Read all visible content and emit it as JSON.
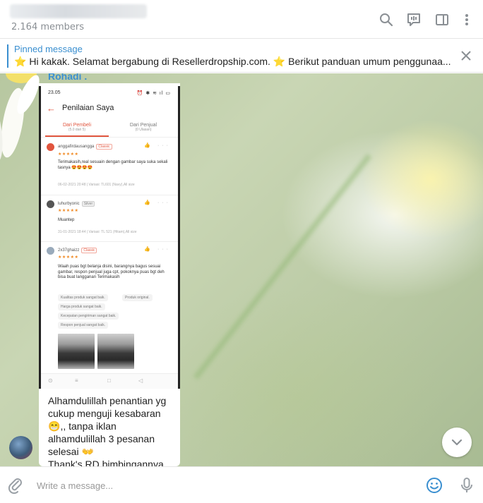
{
  "header": {
    "members": "2.164 members",
    "icons": [
      "search-icon",
      "video-chat-icon",
      "sidebar-toggle-icon",
      "more-vertical-icon"
    ]
  },
  "pinned": {
    "title": "Pinned message",
    "text": "Hi kakak. Selamat bergabung di Resellerdropship.com.",
    "text2": "Berikut panduan umum penggunaa..."
  },
  "message": {
    "sender": "Rohadi .",
    "caption_lines": [
      "Alhamdulillah penantian yg",
      "cukup menguji kesabaran",
      ",, tanpa iklan",
      "alhamdulillah 3 pesanan",
      "selesai",
      "Thank's RD bimbingannya"
    ],
    "screenshot": {
      "time": "23.05",
      "title": "Penilaian Saya",
      "tab1": "Dari Pembeli",
      "tab1_sub": "(5.0 dari 5)",
      "tab2": "Dari Penjual",
      "tab2_sub": "(0 Ulasan)",
      "reviews": [
        {
          "user": "anggafirdausangga",
          "badge": "Classic",
          "stars": "★★★★★",
          "body": "Terimakasih,real sesuain dengan gambar saya suka sekali tasnya",
          "meta": "06-02-2021 20:48 | Variasi: TL601 (Navy),All size"
        },
        {
          "user": "luhurbyonic",
          "badge": "Silver",
          "stars": "★★★★★",
          "body": "Muantep",
          "meta": "31-01-2021 18:44 | Variasi: TL 521 (Hitam),All size"
        },
        {
          "user": "2x37ghaizz",
          "badge": "Classic",
          "stars": "★★★★★",
          "body": "Waah puas bgt belanja disini, barangnya bagus sesuai gambar, respon penjual juga cpt, pokoknya puas bgt deh bisa buat langganan Terimakasih"
        }
      ],
      "chips": [
        "Kualitas produk sangat baik.",
        "Produk original.",
        "Harga produk sangat baik.",
        "Kecepatan pengiriman sangat baik.",
        "Respon penjual sangat baik."
      ]
    }
  },
  "composer": {
    "placeholder": "Write a message..."
  },
  "colors": {
    "accent": "#3a8fd0",
    "shopee": "#e1553e"
  }
}
